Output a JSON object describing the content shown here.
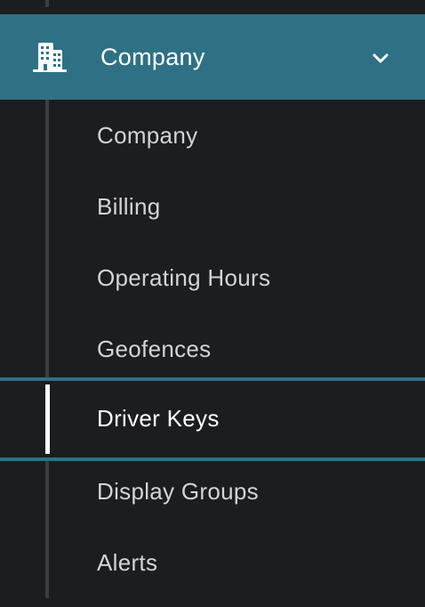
{
  "nav": {
    "parent": {
      "label": "Company",
      "icon": "building-icon",
      "expand_icon": "chevron-down-icon"
    },
    "children": [
      {
        "label": "Company",
        "active": false
      },
      {
        "label": "Billing",
        "active": false
      },
      {
        "label": "Operating Hours",
        "active": false
      },
      {
        "label": "Geofences",
        "active": false
      },
      {
        "label": "Driver Keys",
        "active": true
      },
      {
        "label": "Display Groups",
        "active": false
      },
      {
        "label": "Alerts",
        "active": false
      }
    ]
  },
  "colors": {
    "background": "#1c1d1f",
    "accent": "#2e7185",
    "text": "#d3d4d6",
    "active_text": "#ffffff",
    "guide_line": "#3d3e41"
  }
}
